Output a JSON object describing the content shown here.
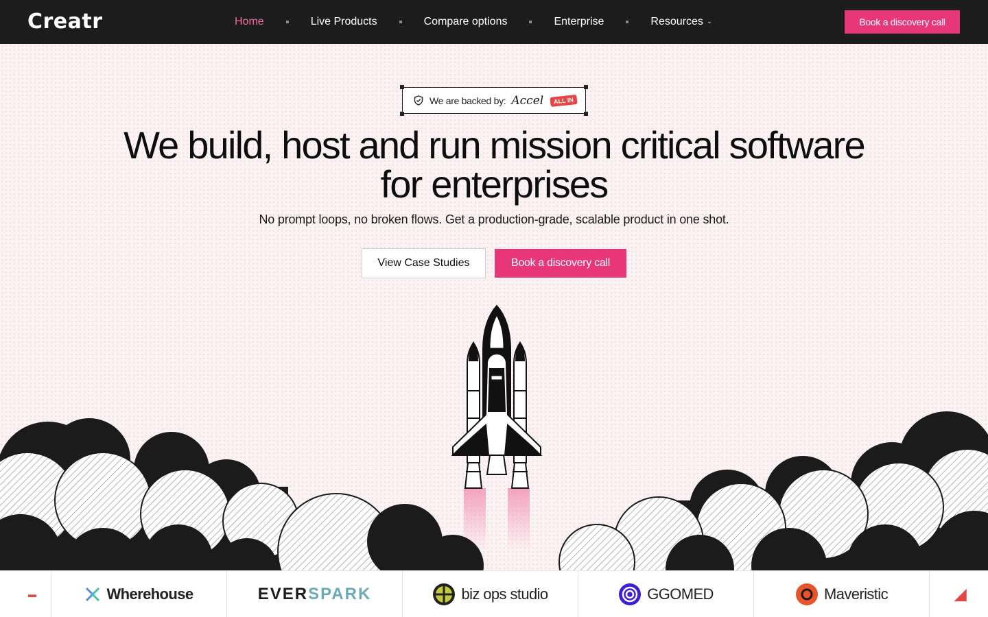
{
  "nav": {
    "logo": "Creatr",
    "links": [
      {
        "label": "Home",
        "active": true
      },
      {
        "label": "Live Products"
      },
      {
        "label": "Compare options"
      },
      {
        "label": "Enterprise"
      },
      {
        "label": "Resources",
        "has_dropdown": true
      }
    ],
    "cta": "Book a discovery call"
  },
  "hero": {
    "badge_text": "We are backed by:",
    "badge_investor_1": "Accel",
    "badge_investor_2": "ALL IN",
    "headline_line1": "We build, host and run mission critical software",
    "headline_line2": "for enterprises",
    "subheadline": "No prompt loops, no broken flows. Get a production-grade, scalable product in one shot.",
    "secondary_cta": "View Case Studies",
    "primary_cta": "Book a discovery call"
  },
  "clients": {
    "logos": [
      "Wherehouse",
      "EVERSPARK",
      "biz ops studio",
      "GGOMED",
      "Maveristic"
    ],
    "everspark_part1": "EVER",
    "everspark_part2": "SPARK"
  },
  "colors": {
    "accent": "#e8367a",
    "nav_bg": "#1c1c1c",
    "active_link": "#f26ba6"
  }
}
